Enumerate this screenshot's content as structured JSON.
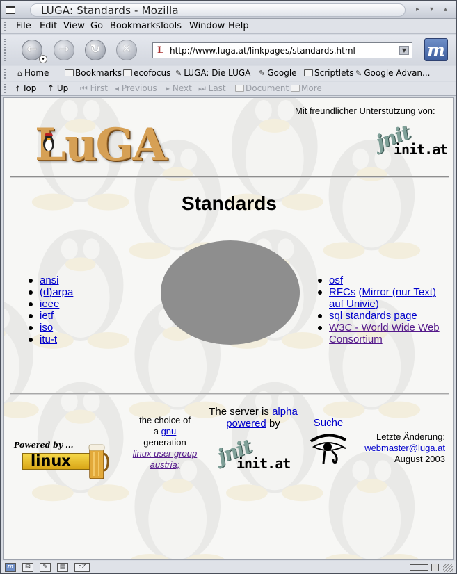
{
  "window": {
    "title": "LUGA: Standards - Mozilla"
  },
  "menubar": {
    "items": [
      {
        "label": "File"
      },
      {
        "label": "Edit"
      },
      {
        "label": "View"
      },
      {
        "label": "Go"
      },
      {
        "label": "Bookmarks"
      },
      {
        "label": "Tools"
      },
      {
        "label": "Window"
      },
      {
        "label": "Help"
      }
    ]
  },
  "navbar": {
    "url": "http://www.luga.at/linkpages/standards.html"
  },
  "bookmarks": {
    "items": [
      {
        "label": "Home",
        "icon": "home-icon"
      },
      {
        "label": "Bookmarks",
        "icon": "folder-icon"
      },
      {
        "label": "ecofocus",
        "icon": "folder-icon"
      },
      {
        "label": "LUGA: Die LUGA",
        "icon": "bookmark-icon"
      },
      {
        "label": "Google",
        "icon": "bookmark-icon"
      },
      {
        "label": "Scriptlets",
        "icon": "folder-icon"
      },
      {
        "label": "Google Advan...",
        "icon": "bookmark-icon"
      }
    ]
  },
  "sitenav": {
    "items": [
      {
        "label": "Top",
        "enabled": true
      },
      {
        "label": "Up",
        "enabled": true
      },
      {
        "label": "First",
        "enabled": false
      },
      {
        "label": "Previous",
        "enabled": false
      },
      {
        "label": "Next",
        "enabled": false
      },
      {
        "label": "Last",
        "enabled": false
      },
      {
        "label": "Document",
        "enabled": false
      },
      {
        "label": "More",
        "enabled": false
      }
    ]
  },
  "page": {
    "sponsor_label": "Mit freundlicher Unterstützung von:",
    "logo_text": "LuGA",
    "sponsor_logo": "init.at",
    "title": "Standards",
    "left_links": [
      "ansi",
      "(d)arpa",
      "ieee",
      "ietf",
      "iso",
      "itu-t"
    ],
    "right_links": {
      "osf": "osf",
      "rfcs": "RFCs",
      "rfcs_mirror_open": "(",
      "rfcs_mirror": "Mirror (nur Text) auf Univie",
      "rfcs_mirror_close": ")",
      "sql": "sql standards page",
      "w3c": "W3C - World Wide Web Consortium"
    },
    "footer": {
      "powered_by": "Powered by ...",
      "powered_os": "linux",
      "choice_line1": "the choice of",
      "choice_a": "a",
      "choice_gnu": "gnu",
      "choice_generation": "generation",
      "choice_link": "linux user group austria;",
      "server_text": "The server is",
      "server_alpha": "alpha",
      "server_powered": "powered",
      "server_by": "by",
      "server_logo": "init.at",
      "search": "Suche",
      "last_change_label": "Letzte Änderung:",
      "webmaster": "webmaster@luga.at",
      "date": "August 2003"
    }
  }
}
